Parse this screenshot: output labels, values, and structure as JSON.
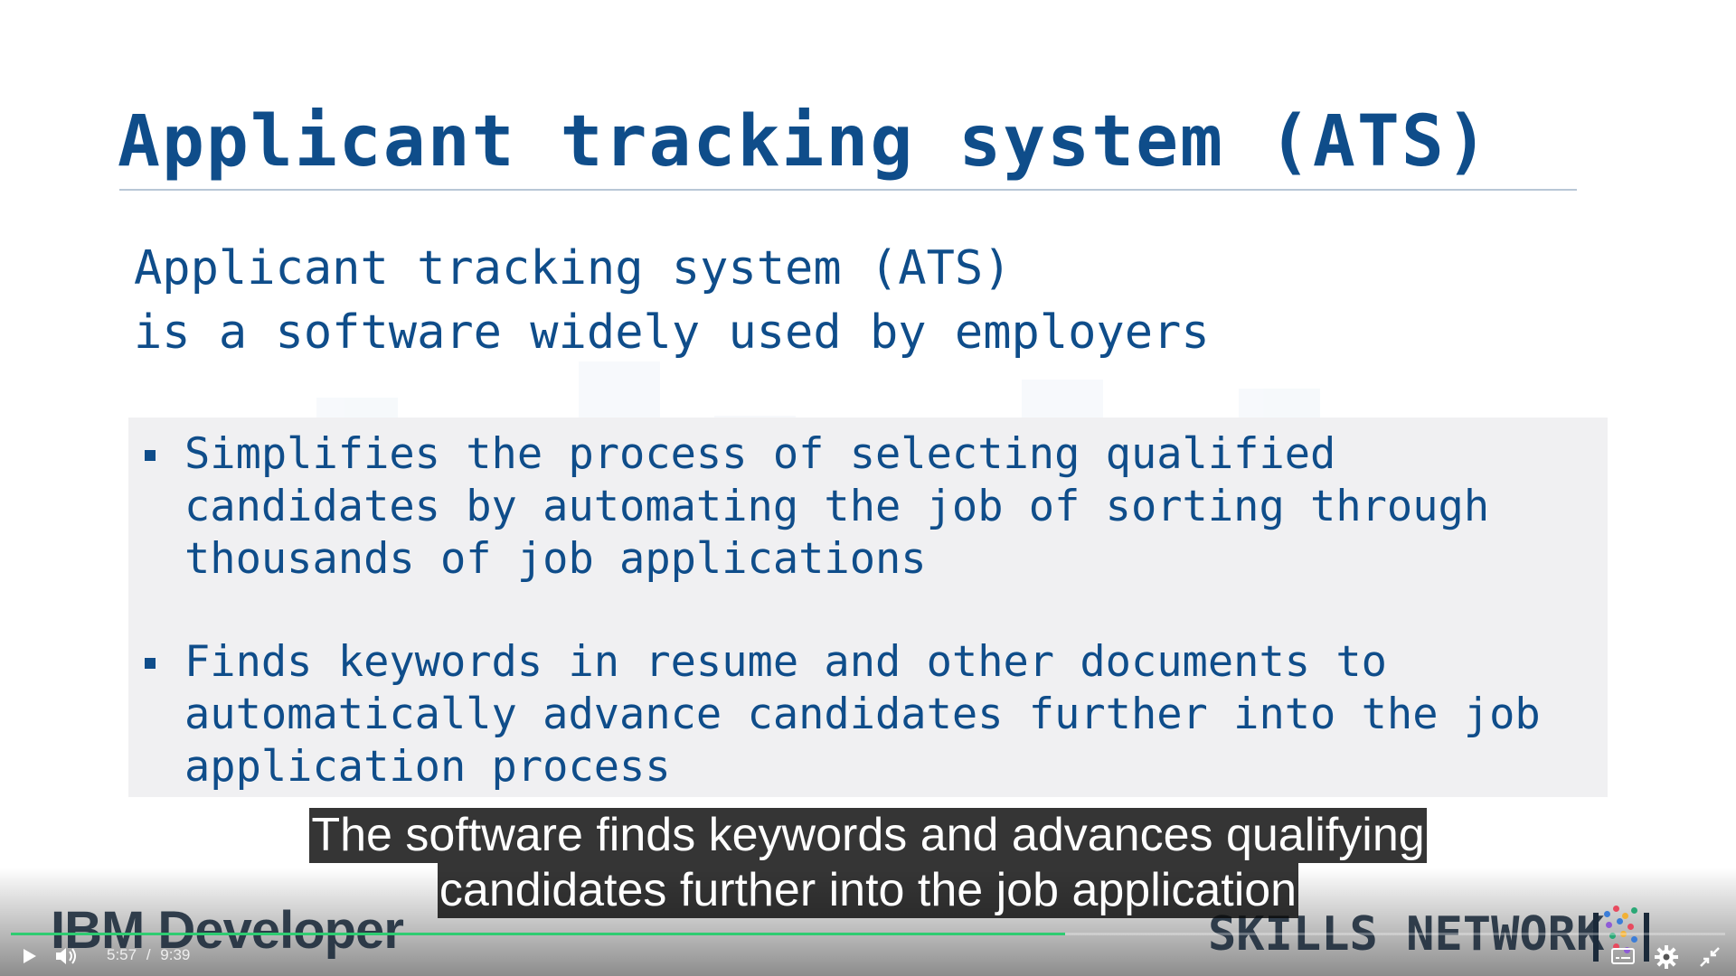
{
  "slide": {
    "title": "Applicant tracking system (ATS)",
    "intro_lines": [
      "Applicant tracking system (ATS)",
      "is a software widely used by employers"
    ],
    "bullets": [
      {
        "lines": [
          "Simplifies the process of selecting qualified",
          "candidates by automating the job of sorting through",
          "thousands of job applications"
        ]
      },
      {
        "lines": [
          "Finds keywords in resume and other documents to",
          "automatically advance candidates further into the job",
          "application process"
        ]
      }
    ],
    "colors": {
      "title": "#0f4d8a",
      "box": "#f0f0f2"
    }
  },
  "captions": {
    "lines": [
      "The software finds keywords and advances qualifying",
      "candidates further into the job application"
    ]
  },
  "branding": {
    "left_logo": "IBM Developer",
    "right_logo": "SKILLS NETWORK"
  },
  "player": {
    "current_time": "5:57",
    "separator": "/",
    "duration": "9:39",
    "progress_fraction": 0.615,
    "progress_color": "#2ecc71",
    "icons": {
      "play": "play-icon",
      "volume": "volume-icon",
      "captions": "captions-icon",
      "settings": "settings-icon",
      "exit_fullscreen": "exit-fullscreen-icon"
    }
  }
}
